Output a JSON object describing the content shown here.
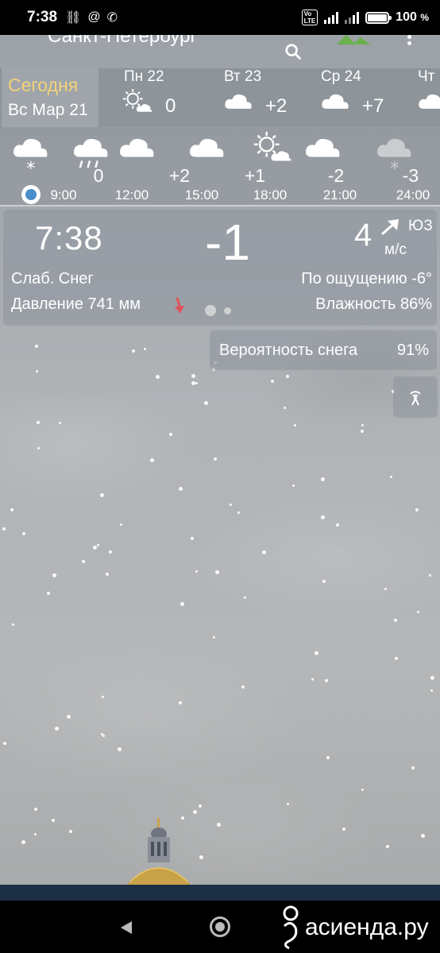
{
  "status_bar": {
    "time": "7:38",
    "battery_percent": "100",
    "battery_pct_suffix": "%",
    "battery_level": 1.0,
    "network": "4G+"
  },
  "header": {
    "city": "Санкт-Петербург"
  },
  "today": {
    "label": "Сегодня",
    "date": "Вс Мар 21"
  },
  "days": [
    {
      "name": "Пн 22",
      "icon": "sun-cloud-icon",
      "temp": "0"
    },
    {
      "name": "Вт 23",
      "icon": "cloud-icon",
      "temp": "+2"
    },
    {
      "name": "Ср 24",
      "icon": "cloud-icon",
      "temp": "+7"
    },
    {
      "name": "Чт",
      "icon": "cloud-icon",
      "temp": ""
    }
  ],
  "hourly": [
    {
      "time": "9:00",
      "icon": "snow-icon",
      "temp": ""
    },
    {
      "time": "12:00",
      "icon": "rain-icon",
      "temp": "0"
    },
    {
      "time": "15:00",
      "icon": "cloud-icon",
      "temp": "+2"
    },
    {
      "time": "18:00",
      "icon": "cloud-icon",
      "temp": "+1"
    },
    {
      "time": "21:00",
      "icon": "sun-cloud-icon",
      "temp": "-2"
    },
    {
      "time": "24:00",
      "icon": "cloud-icon",
      "temp": "-3"
    },
    {
      "time": "",
      "icon": "snow-icon",
      "temp": ""
    }
  ],
  "current": {
    "time": "7:38",
    "temp": "-1",
    "wind_speed": "4",
    "wind_dir": "ЮЗ",
    "wind_unit": "м/с",
    "condition": "Слаб. Снег",
    "feels_like": "По ощущению -6°",
    "pressure": "Давление 741 мм",
    "humidity": "Влажность 86%"
  },
  "snow_chance": {
    "label": "Вероятность снега",
    "value": "91%"
  },
  "watermark": "асиенда.ру",
  "colors": {
    "today_label": "#f5d27a",
    "pressure_arrow": "#e0525a",
    "now_dot": "#4a8fc9"
  }
}
